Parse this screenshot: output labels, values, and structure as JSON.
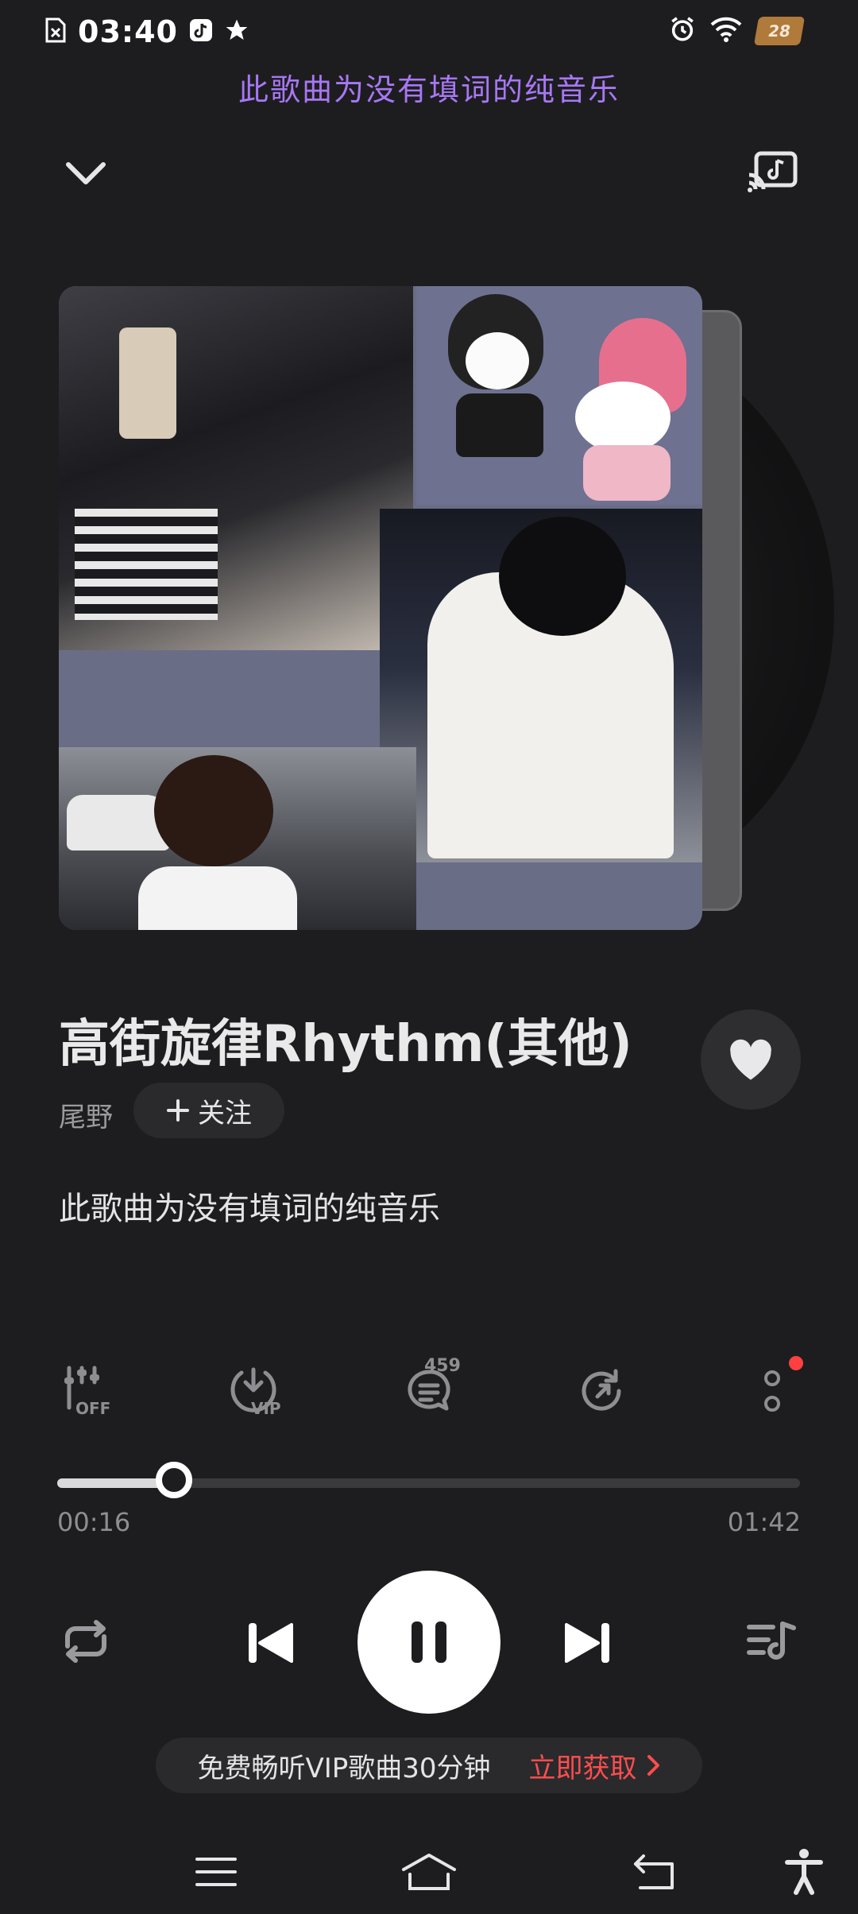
{
  "status_bar": {
    "time": "03:40",
    "battery": "28",
    "icons": [
      "sim-icon",
      "tiktok-icon",
      "star-icon",
      "alarm-icon",
      "wifi-icon",
      "battery-icon"
    ]
  },
  "top_lyric": "此歌曲为没有填词的纯音乐",
  "header": {
    "collapse_icon": "chevron-down-icon",
    "cast_icon": "cast-music-icon"
  },
  "song": {
    "title": "高街旋律Rhythm(其他)",
    "artist": "尾野",
    "follow_label": "关注",
    "lyric": "此歌曲为没有填词的纯音乐"
  },
  "tools": {
    "sound_effect_state": "OFF",
    "download_badge": "VIP",
    "comment_count": "459"
  },
  "progress": {
    "current": "00:16",
    "total": "01:42",
    "fraction": 0.157
  },
  "banner": {
    "text": "免费畅听VIP歌曲30分钟",
    "cta": "立即获取"
  },
  "colors": {
    "background": "#1d1d1f",
    "accent_lyric": "#a778f5",
    "cta_red": "#ff4d4d"
  }
}
